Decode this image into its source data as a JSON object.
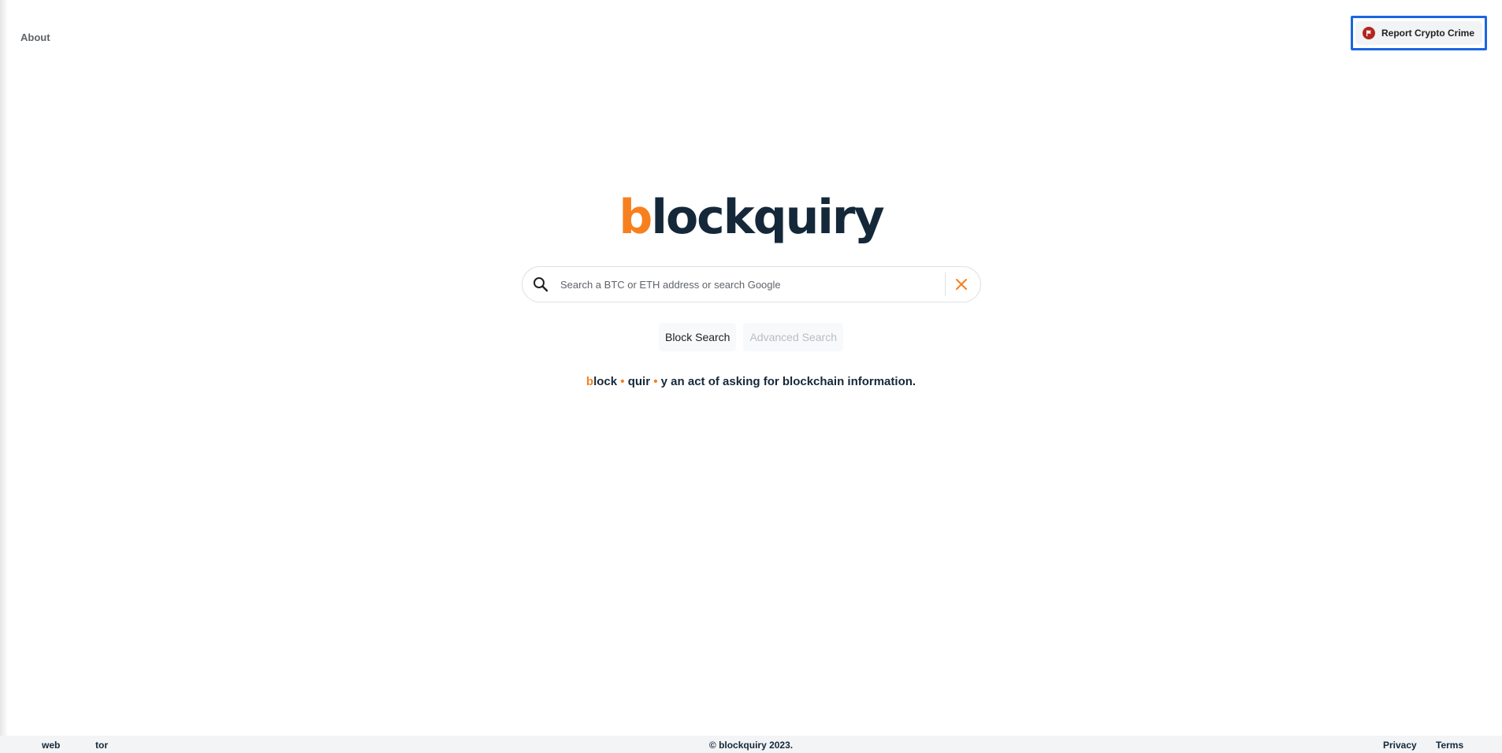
{
  "header": {
    "about_label": "About",
    "report_label": "Report Crypto Crime",
    "report_icon": "flag-icon"
  },
  "logo": {
    "first_letter": "b",
    "rest": "lockquiry"
  },
  "search": {
    "placeholder": "Search a BTC or ETH address or search Google",
    "value": "",
    "search_icon": "search-icon",
    "clear_icon": "close-icon"
  },
  "buttons": {
    "block_search": "Block Search",
    "advanced_search": "Advanced Search"
  },
  "tagline": {
    "part1_accent": "b",
    "part1_rest": "lock",
    "dot": "•",
    "part2": "quir",
    "part3": "y an act of asking for blockchain information."
  },
  "footer": {
    "web": "web",
    "tor": "tor",
    "copyright": "© blockquiry 2023.",
    "privacy": "Privacy",
    "terms": "Terms"
  },
  "colors": {
    "accent": "#f7801e",
    "brand_dark": "#14283a",
    "focus_outline": "#1a66e0",
    "report_icon_bg": "#b3261e"
  }
}
